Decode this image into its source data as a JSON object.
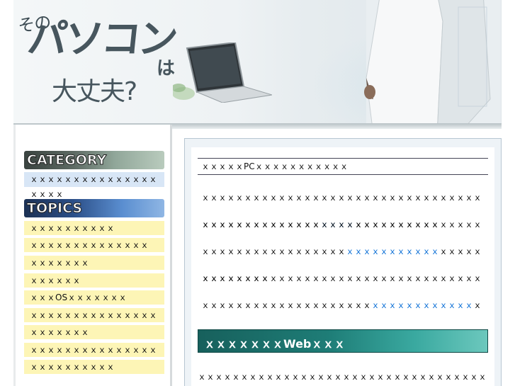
{
  "header": {
    "title_small": "その",
    "title_main": "パソコン",
    "title_ha": "は",
    "title_sub": "大丈夫?"
  },
  "sidebar": {
    "category_heading": "CATEGORY",
    "category_items": [
      "ｘｘｘｘｘｘｘｘｘｘｘｘｘｘｘｘｘｘｘ"
    ],
    "topics_heading": "TOPICS",
    "topic_items": [
      "ｘｘｘｘｘｘｘｘｘｘ",
      "ｘｘｘｘｘｘｘｘｘｘｘｘｘｘ",
      "ｘｘｘｘｘｘｘ",
      "ｘｘｘｘｘｘ",
      "ｘｘｘOSｘｘｘｘｘｘｘ",
      "ｘｘｘｘｘｘｘｘｘｘｘｘｘｘｘｘ",
      "ｘｘｘｘｘｘｘ",
      "ｘｘｘｘｘｘｘｘｘｘｘｘｘｘｘｘｘｘ",
      "ｘｘｘｘｘｘｘｘｘｘ"
    ]
  },
  "main": {
    "article_title": "ｘｘｘｘｘPCｘｘｘｘｘｘｘｘｘｘｘ",
    "p1_pre": "ｘｘｘｘｘｘｘｘｘｘｘｘｘｘｘｘｘｘｘｘｘｘｘｘｘｘｘｘｘｘｘｘｘｘｘｘｘｘｘｘｘｘｘｘｘｘｘ",
    "p1_link": "ｘｘｘｘ",
    "p1_post": "ｘｘｘｘｘｘｘｘｘｘ",
    "p2_pre": "ｘｘｘｘｘｘｘｘｘｘｘｘｘｘｘｘｘｘｘｘｘｘｘｘｘｘｘｘｘｘｘｘｘｘｘｘｘｘｘｘｘｘｘｘｘｘｘｘｘｘ",
    "p2_link": "ｘｘｘｘｘｘｘｘｘｘｘ",
    "p2_post": "ｘｘ",
    "p2_tail": "ｘｘｘｘｘｘｘｘｘｘｘ",
    "p3_pre": "ｘｘｘｘｘｘｘｘｘｘｘｘｘｘｘｘｘｘｘｘｘｘｘｘｘｘｘｘｘｘｘｘｘｘｘｘｘｘｘｘｘｘｘｘｘｘｘｘｘｘｘｘｘ",
    "p3_link": "ｘｘｘｘｘｘｘｘｘｘｘｘ",
    "p3_post": "ｘｘｘｘｘｘｘｘｘｘ",
    "section_heading": "ｘｘｘｘｘｘｘWebｘｘｘ",
    "bottom_text": "ｘｘｘｘｘｘｘｘｘｘｘｘｘｘｘｘｘｘｘｘｘｘｘｘｘｘｘｘｘｘｘｘｘｘｘｘｘｘｘｘｘｘｘｘｘｘｘｘｘｘｘｘ"
  },
  "colors": {
    "link": "#0b6fd6",
    "category_item_bg": "#d8e6f6",
    "topic_item_bg": "#fdf5b6",
    "section_banner": "#1e7d77"
  }
}
